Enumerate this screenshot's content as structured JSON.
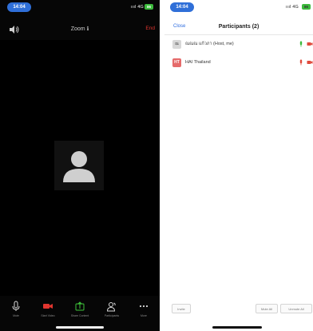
{
  "colors": {
    "time_pill": "#2f6fd8",
    "end_red": "#e0352f",
    "video_icon_red": "#e0352f",
    "share_green": "#3ec43a",
    "mic_green": "#3cba3c",
    "mic_red": "#e04a3c",
    "battery_green": "#3cba3c",
    "host_avatar_bg": "#d8d8d8",
    "hai_avatar_bg": "#e56a6a",
    "blue_link": "#2d6cdf"
  },
  "left_screen": {
    "status": {
      "time": "14:04",
      "signal_text": "ıııl 4G",
      "battery": "86"
    },
    "top_bar": {
      "audio_icon": "speaker-icon",
      "title": "Zoom ℹ",
      "end_label": "End"
    },
    "toolbar": [
      {
        "id": "mute",
        "icon": "microphone-icon",
        "label": "Mute"
      },
      {
        "id": "video",
        "icon": "video-camera-icon",
        "label": "Start Video"
      },
      {
        "id": "share",
        "icon": "share-screen-icon",
        "label": "Share Content"
      },
      {
        "id": "participants",
        "icon": "participants-icon",
        "label": "Participants"
      },
      {
        "id": "more",
        "icon": "more-dots-icon",
        "label": "More"
      }
    ]
  },
  "right_screen": {
    "status": {
      "time": "14:04",
      "signal_text": "ıııl 4G",
      "battery": "86"
    },
    "nav": {
      "close_label": "Close",
      "title": "Participants (2)"
    },
    "participants": [
      {
        "avatar_text": "ณ",
        "name": "ณณณ แก้วภา (Host, me)",
        "mic_icon": "microphone-on-icon",
        "video_icon": "video-off-icon"
      },
      {
        "avatar_text": "HT",
        "name": "HAI Thailand",
        "mic_icon": "microphone-muted-icon",
        "video_icon": "video-off-icon"
      }
    ],
    "footer": {
      "invite_label": "Invite",
      "mute_all_label": "Mute All",
      "unmute_all_label": "Unmute All"
    }
  }
}
